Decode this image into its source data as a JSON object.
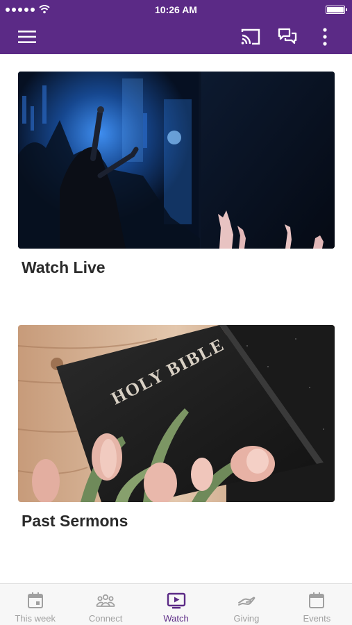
{
  "status_bar": {
    "time": "10:26 AM"
  },
  "header": {
    "icons": [
      "menu-icon",
      "cast-icon",
      "chat-icon",
      "more-icon"
    ]
  },
  "cards": [
    {
      "title": "Watch Live"
    },
    {
      "title": "Past Sermons",
      "image_text": "HOLY BIBLE"
    }
  ],
  "tabs": [
    {
      "label": "This week",
      "icon": "calendar-day-icon",
      "active": false
    },
    {
      "label": "Connect",
      "icon": "people-icon",
      "active": false
    },
    {
      "label": "Watch",
      "icon": "play-screen-icon",
      "active": true
    },
    {
      "label": "Giving",
      "icon": "giving-hand-icon",
      "active": false
    },
    {
      "label": "Events",
      "icon": "calendar-icon",
      "active": false
    }
  ],
  "colors": {
    "brand": "#5b2a86",
    "tab_inactive": "#a0a0a0",
    "title": "#2a2a2a"
  }
}
